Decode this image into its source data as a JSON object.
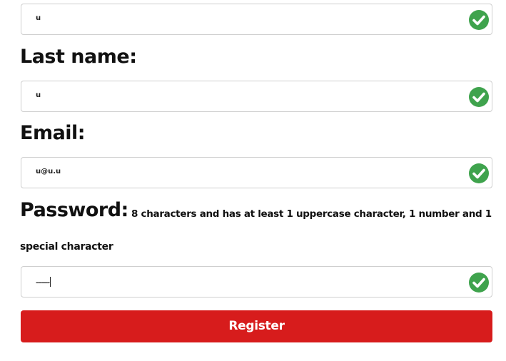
{
  "form": {
    "first_name": {
      "value": "u"
    },
    "last_name": {
      "label": "Last name:",
      "value": "u"
    },
    "email": {
      "label": "Email:",
      "value": "u@u.u"
    },
    "password": {
      "label": "Password:",
      "hint_line1": "8 characters and has at least 1 uppercase character, 1 number and 1",
      "hint_line2": "special character",
      "value": "-------"
    },
    "register_label": "Register"
  },
  "colors": {
    "valid_check": "#3fa34d",
    "register_button": "#d71c1c"
  },
  "icons": {
    "valid": "check-circle-icon"
  }
}
